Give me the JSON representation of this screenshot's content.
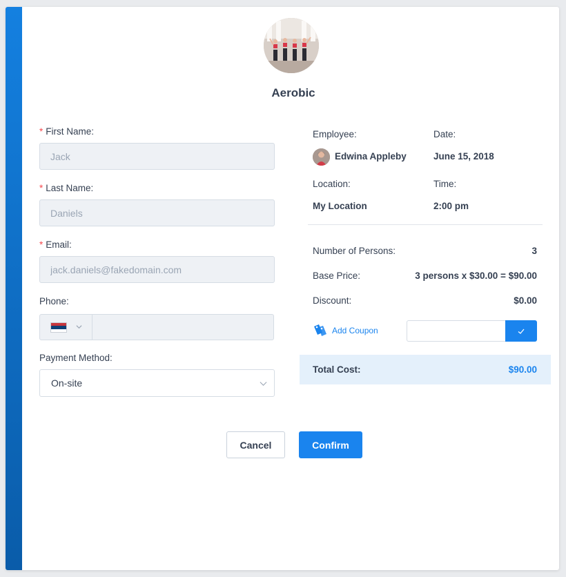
{
  "service": {
    "name": "Aerobic",
    "photo_icon": "aerobic-class-photo"
  },
  "form": {
    "first_name": {
      "label": "First Name:",
      "value": "Jack",
      "required": "*"
    },
    "last_name": {
      "label": "Last Name:",
      "value": "Daniels",
      "required": "*"
    },
    "email": {
      "label": "Email:",
      "value": "jack.daniels@fakedomain.com",
      "required": "*"
    },
    "phone": {
      "label": "Phone:",
      "value": "",
      "country_flag": "serbia-flag-icon"
    },
    "payment_method": {
      "label": "Payment Method:",
      "value": "On-site"
    }
  },
  "booking": {
    "employee_label": "Employee:",
    "employee_name": "Edwina Appleby",
    "date_label": "Date:",
    "date_value": "June 15, 2018",
    "location_label": "Location:",
    "location_value": "My Location",
    "time_label": "Time:",
    "time_value": "2:00 pm"
  },
  "pricing": {
    "persons_label": "Number of Persons:",
    "persons_value": "3",
    "base_price_label": "Base Price:",
    "base_price_value": "3 persons x $30.00 = $90.00",
    "discount_label": "Discount:",
    "discount_value": "$0.00",
    "coupon_link": "Add Coupon",
    "coupon_placeholder": "",
    "total_label": "Total Cost:",
    "total_value": "$90.00"
  },
  "actions": {
    "cancel": "Cancel",
    "confirm": "Confirm"
  },
  "colors": {
    "accent": "#1a84ee",
    "text": "#354052",
    "required": "#f5484e",
    "total_bg": "#e4f0fb",
    "sidebar": "#0a5ca9"
  }
}
